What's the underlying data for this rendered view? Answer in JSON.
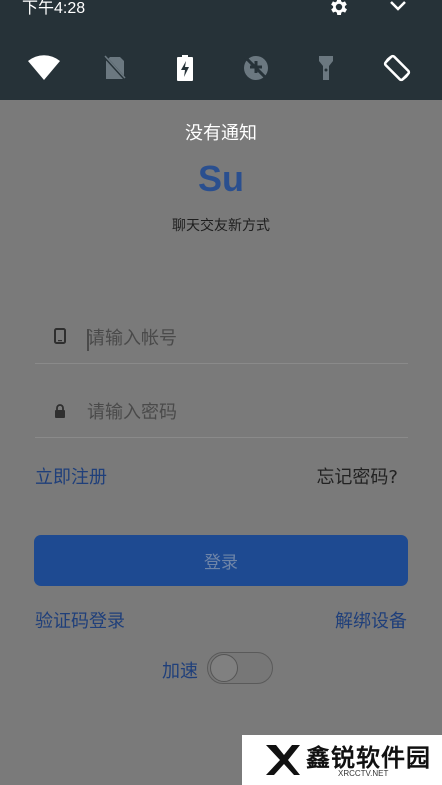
{
  "status": {
    "time": "下午4:28",
    "settings_icon": "gear-icon",
    "expand_icon": "chevron-down-icon"
  },
  "quick_settings": [
    {
      "name": "wifi-icon"
    },
    {
      "name": "no-sim-icon"
    },
    {
      "name": "battery-charging-icon"
    },
    {
      "name": "data-saver-off-icon"
    },
    {
      "name": "flashlight-icon"
    },
    {
      "name": "auto-rotate-icon"
    }
  ],
  "notifications": {
    "empty_text": "没有通知"
  },
  "app": {
    "logo": "Su",
    "slogan": "聊天交友新方式"
  },
  "login": {
    "account_placeholder": "请输入帐号",
    "password_placeholder": "请输入密码",
    "register_label": "立即注册",
    "forgot_label": "忘记密码?",
    "login_label": "登录",
    "code_login_label": "验证码登录",
    "unbind_label": "解绑设备",
    "speed_label": "加速",
    "speed_on": false
  },
  "watermark": {
    "brand": "鑫锐软件园",
    "sub": "XRCCTV.NET"
  },
  "colors": {
    "shade": "#263238",
    "accent": "#1e4a91",
    "link": "#1f3f7a",
    "scrim": "#7a7a7a"
  }
}
